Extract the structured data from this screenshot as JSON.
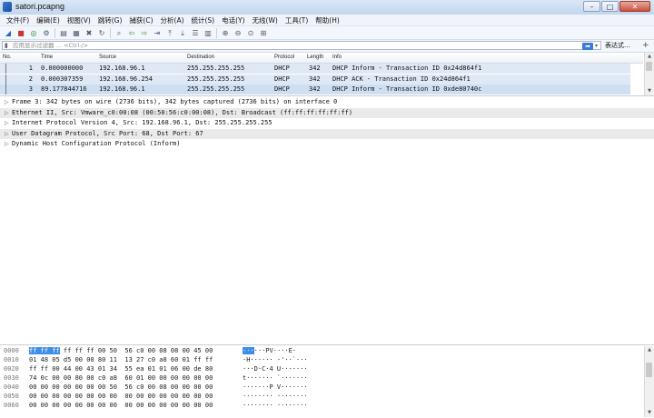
{
  "window": {
    "title": "satori.pcapng",
    "controls": [
      "–",
      "□",
      "✕"
    ]
  },
  "menu": [
    "文件(F)",
    "编辑(E)",
    "视图(V)",
    "跳转(G)",
    "捕获(C)",
    "分析(A)",
    "统计(S)",
    "电话(Y)",
    "无线(W)",
    "工具(T)",
    "帮助(H)"
  ],
  "toolbar_icons": [
    {
      "name": "start-capture-icon",
      "glyph": "◢",
      "cls": "blue"
    },
    {
      "name": "stop-capture-icon",
      "glyph": "■",
      "cls": "red"
    },
    {
      "name": "restart-capture-icon",
      "glyph": "◎",
      "cls": "green"
    },
    {
      "name": "capture-options-icon",
      "glyph": "⚙",
      "cls": ""
    },
    {
      "name": "sep",
      "glyph": "",
      "cls": ""
    },
    {
      "name": "open-file-icon",
      "glyph": "▤",
      "cls": ""
    },
    {
      "name": "save-file-icon",
      "glyph": "▦",
      "cls": ""
    },
    {
      "name": "close-file-icon",
      "glyph": "✖",
      "cls": ""
    },
    {
      "name": "reload-icon",
      "glyph": "↻",
      "cls": ""
    },
    {
      "name": "sep",
      "glyph": "",
      "cls": ""
    },
    {
      "name": "find-packet-icon",
      "glyph": "⌕",
      "cls": ""
    },
    {
      "name": "go-back-icon",
      "glyph": "⇦",
      "cls": "green"
    },
    {
      "name": "go-forward-icon",
      "glyph": "⇨",
      "cls": "green"
    },
    {
      "name": "go-to-packet-icon",
      "glyph": "⇥",
      "cls": ""
    },
    {
      "name": "first-packet-icon",
      "glyph": "⤒",
      "cls": ""
    },
    {
      "name": "last-packet-icon",
      "glyph": "⤓",
      "cls": ""
    },
    {
      "name": "autoscroll-icon",
      "glyph": "☰",
      "cls": ""
    },
    {
      "name": "colorize-icon",
      "glyph": "▥",
      "cls": ""
    },
    {
      "name": "sep",
      "glyph": "",
      "cls": ""
    },
    {
      "name": "zoom-in-icon",
      "glyph": "⊕",
      "cls": ""
    },
    {
      "name": "zoom-out-icon",
      "glyph": "⊖",
      "cls": ""
    },
    {
      "name": "zoom-normal-icon",
      "glyph": "⊙",
      "cls": ""
    },
    {
      "name": "resize-columns-icon",
      "glyph": "⊞",
      "cls": ""
    }
  ],
  "filter": {
    "placeholder": "应用显示过滤器 … <Ctrl-/>",
    "apply_glyph": "➡",
    "dropdown_glyph": "▾",
    "expression_label": "表达式…",
    "plus_label": "+"
  },
  "packet_list": {
    "columns": [
      "No.",
      "Time",
      "Source",
      "Destination",
      "Protocol",
      "Length",
      "Info"
    ],
    "rows": [
      {
        "no": "1",
        "time": "0.000000000",
        "source": "192.168.96.1",
        "destination": "255.255.255.255",
        "protocol": "DHCP",
        "length": "342",
        "info": "DHCP Inform    - Transaction ID 0x24d864f1",
        "selected": false
      },
      {
        "no": "2",
        "time": "0.000307359",
        "source": "192.168.96.254",
        "destination": "255.255.255.255",
        "protocol": "DHCP",
        "length": "342",
        "info": "DHCP ACK       - Transaction ID 0x24d864f1",
        "selected": false
      },
      {
        "no": "3",
        "time": "89.177844716",
        "source": "192.168.96.1",
        "destination": "255.255.255.255",
        "protocol": "DHCP",
        "length": "342",
        "info": "DHCP Inform    - Transaction ID 0xde80740c",
        "selected": true
      }
    ]
  },
  "details": [
    "Frame 3: 342 bytes on wire (2736 bits), 342 bytes captured (2736 bits) on interface 0",
    "Ethernet II, Src: Vmware_c0:00:08 (00:50:56:c0:00:08), Dst: Broadcast (ff:ff:ff:ff:ff:ff)",
    "Internet Protocol Version 4, Src: 192.168.96.1, Dst: 255.255.255.255",
    "User Datagram Protocol, Src Port: 68, Dst Port: 67",
    "Dynamic Host Configuration Protocol (Inform)"
  ],
  "hex": [
    {
      "off": "0000",
      "hl": "ff ff ff",
      "bytes": " ff ff ff 00 50  56 c0 00 08 08 00 45 00",
      "ahl": "···",
      "ascii": "···PV····E·"
    },
    {
      "off": "0010",
      "hl": "",
      "bytes": "01 48 05 d5 00 00 80 11  13 27 c0 a8 60 01 ff ff",
      "ahl": "",
      "ascii": "·H······ ·'··`···"
    },
    {
      "off": "0020",
      "hl": "",
      "bytes": "ff ff 00 44 00 43 01 34  55 ea 01 01 06 00 de 80",
      "ahl": "",
      "ascii": "···D·C·4 U·······"
    },
    {
      "off": "0030",
      "hl": "",
      "bytes": "74 0c 00 00 80 00 c0 a8  60 01 00 00 00 00 00 00",
      "ahl": "",
      "ascii": "t······· `·······"
    },
    {
      "off": "0040",
      "hl": "",
      "bytes": "00 00 00 00 00 00 00 50  56 c0 00 08 00 00 00 00",
      "ahl": "",
      "ascii": "·······P V·······"
    },
    {
      "off": "0050",
      "hl": "",
      "bytes": "00 00 00 00 00 00 00 00  00 00 00 00 00 00 00 00",
      "ahl": "",
      "ascii": "········ ········"
    },
    {
      "off": "0060",
      "hl": "",
      "bytes": "00 00 00 00 00 00 00 00  00 00 00 00 00 00 00 00",
      "ahl": "",
      "ascii": "········ ········"
    }
  ]
}
